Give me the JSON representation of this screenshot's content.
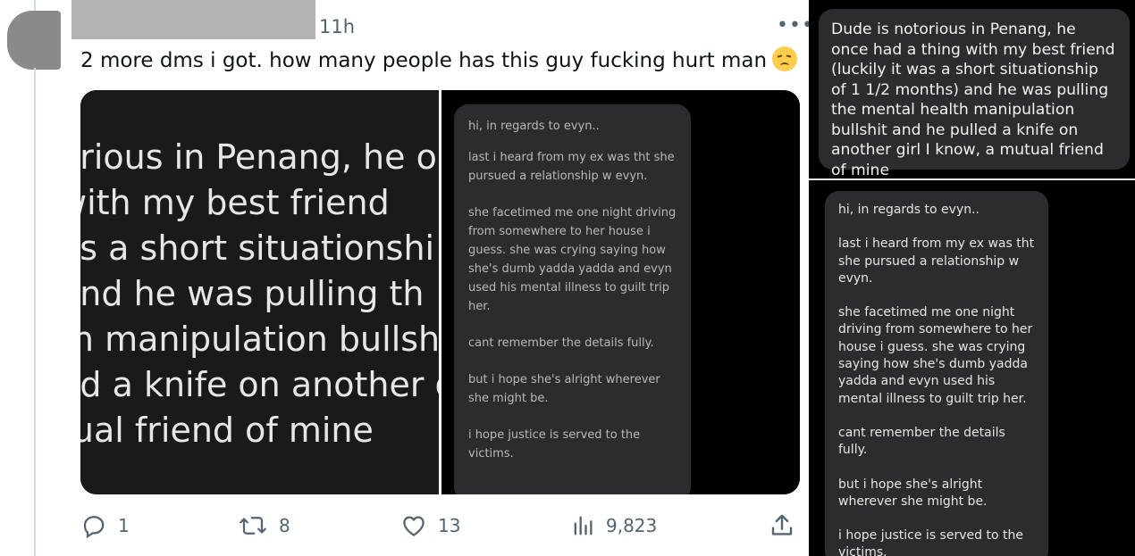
{
  "tweet": {
    "timestamp": "11h",
    "text": "2 more dms i got. how many people has this guy fucking hurt man",
    "emoji_icon": "disappointed-face-emoji",
    "more_label": "•••",
    "media": {
      "left_image_lines": [
        "orious in Penang, he o",
        "with my best friend",
        "as a short situationshi",
        "and he was pulling th",
        "th manipulation bullsh",
        "ed a knife on another g",
        "tual friend of mine"
      ],
      "right_image_dm": [
        "hi, in regards to evyn..",
        "last i heard from my ex was tht she pursued a relationship w evyn.",
        "she facetimed me one night driving from somewhere to her house i guess. she was crying saying how she's dumb yadda yadda and evyn used his mental illness to guilt trip her.",
        "cant remember the details fully.",
        "but i hope she's alright wherever she might be.",
        "i hope justice is served to the victims."
      ]
    },
    "actions": {
      "replies": "1",
      "retweets": "8",
      "likes": "13",
      "views": "9,823"
    },
    "colors": {
      "text": "#0f1419",
      "muted": "#536471",
      "redaction": "#b3b3b3"
    }
  },
  "right_panel": {
    "top_message": "Dude is notorious in Penang, he once had a thing with my best friend (luckily it was a short situationship of 1 1/2 months) and he was pulling the mental health manipulation bullshit and he pulled a knife on another girl I know, a mutual friend of mine",
    "dm_paragraphs": [
      "hi, in regards to evyn..",
      "last i heard from my ex was tht she pursued a relationship w evyn.",
      "she facetimed me one night driving from somewhere to her house i guess. she was crying saying how she's dumb yadda yadda and evyn used his mental illness to guilt trip her.",
      "cant remember the details fully.",
      "but i hope she's alright wherever she might be.",
      "i hope justice is served to the victims."
    ],
    "colors": {
      "background": "#000000",
      "bubble": "#2c2c2e"
    }
  }
}
